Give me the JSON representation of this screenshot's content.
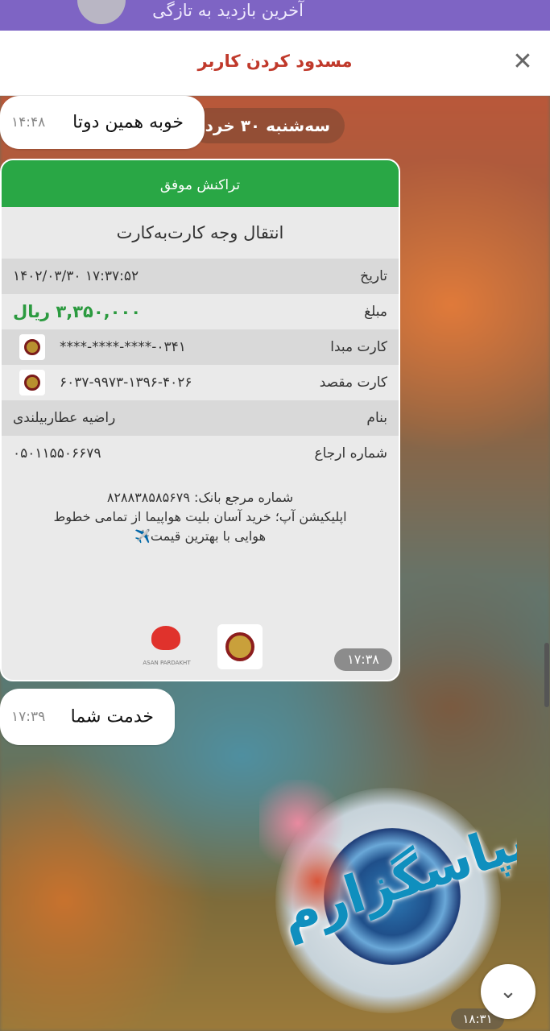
{
  "topbar": {
    "subtitle": "آخرین بازدید به تازگی"
  },
  "sheet": {
    "title": "مسدود کردن کاربر",
    "close_icon": "close-icon"
  },
  "date_chip": "سه‌شنبه ۳۰ خرداد",
  "messages": [
    {
      "text": "خوبه همین دوتا",
      "time": "۱۴:۴۸"
    },
    {
      "text": "خدمت شما",
      "time": "۱۷:۳۹"
    }
  ],
  "receipt": {
    "status": "تراکنش موفق",
    "type": "انتقال وجه کارت‌به‌کارت",
    "rows": [
      {
        "label": "تاریخ",
        "value": "۱۴۰۲/۰۳/۳۰ ۱۷:۳۷:۵۲"
      },
      {
        "label": "مبلغ",
        "value": "۳,۳۵۰,۰۰۰ ریال"
      },
      {
        "label": "کارت مبدا",
        "value": "****-****-****-۰۳۴۱"
      },
      {
        "label": "کارت مقصد",
        "value": "۶۰۳۷-۹۹۷۳-۱۳۹۶-۴۰۲۶"
      },
      {
        "label": "بنام",
        "value": "راضیه عطاربیلندی"
      },
      {
        "label": "شماره ارجاع",
        "value": "۰۵۰۱۱۵۵۰۶۶۷۹"
      }
    ],
    "note_line1": "شماره مرجع بانک: ۸۲۸۸۳۸۵۸۵۶۷۹",
    "note_line2": "اپلیکیشن آپ؛ خرید آسان بلیت هواپیما از تمامی خطوط",
    "note_line3": "هوایی با بهترین قیمت✈️",
    "logo_caption": "ASAN PARDAKHT",
    "time": "۱۷:۳۸"
  },
  "sticker": {
    "text": "سپاسگزارم",
    "time": "۱۸:۳۱"
  },
  "colors": {
    "topbar": "#7e64c4",
    "success": "#29a745",
    "title_red": "#c0392b"
  }
}
